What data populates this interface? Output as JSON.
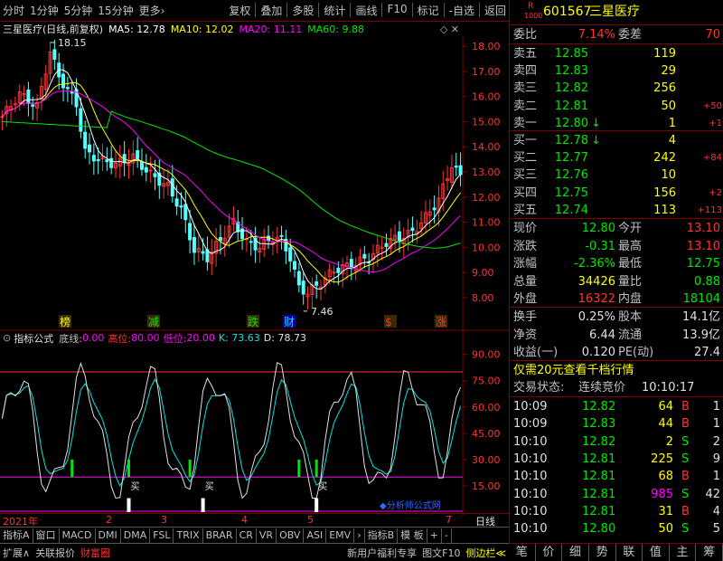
{
  "toolbar": {
    "left_items": [
      "分时",
      "1分钟",
      "5分钟",
      "15分钟",
      "更多›"
    ],
    "right_items": [
      "复权",
      "叠加",
      "多股",
      "统计",
      "画线",
      "F10",
      "标记",
      "-自选",
      "返回"
    ]
  },
  "chart_title": {
    "name": "三星医疗(日线,前复权)",
    "ma5": "MA5: 12.78",
    "ma10": "MA10: 12.02",
    "ma20": "MA20: 11.11",
    "ma60": "MA60: 9.88"
  },
  "chart_data": [
    {
      "type": "candlestick",
      "y_ticks": [
        "18.00",
        "17.00",
        "16.00",
        "15.00",
        "14.00",
        "13.00",
        "12.00",
        "11.00",
        "10.00",
        "9.00",
        "8.00"
      ],
      "ylim": [
        7.6,
        18.4
      ],
      "high_label": "18.15",
      "low_label": "7.46",
      "markers": [
        "榜",
        "减",
        "跌",
        "财",
        "$",
        "涨"
      ],
      "series_colors": {
        "ma5": "#ffffff",
        "ma10": "#ffff00",
        "ma20": "#ff00ff",
        "ma60": "#00e600"
      }
    },
    {
      "type": "line",
      "y_ticks": [
        "90.00",
        "75.00",
        "60.00",
        "45.00",
        "30.00",
        "15.00"
      ],
      "ylim": [
        0,
        95
      ],
      "buy_label": "买",
      "series_colors": {
        "k": "#e0e0e0",
        "d": "#00e6e6"
      }
    }
  ],
  "indicator": {
    "name": "指标公式",
    "floor_label": "底线:",
    "floor_value": "0.00",
    "high_label": "高位:",
    "high_value": "80.00",
    "low_label": "低位:",
    "low_value": "20.00",
    "k": "K: 73.63",
    "d": "D: 78.73",
    "link": "◆分析师公式网"
  },
  "xaxis": {
    "year": "2021年",
    "months": [
      "2",
      "3",
      "4",
      "5",
      "7"
    ],
    "period": "日线"
  },
  "tabs": [
    "指标A",
    "窗口",
    "MACD",
    "DMI",
    "DMA",
    "FSL",
    "TRIX",
    "BRAR",
    "CR",
    "VR",
    "OBV",
    "ASI",
    "EMV",
    "›",
    "指标B",
    "模 板",
    "+",
    "-"
  ],
  "bottom": {
    "left": [
      "扩展∧",
      "关联报价",
      "财富圈"
    ],
    "right": [
      "新用户福利专享",
      "图文F10",
      "侧边栏≪"
    ]
  },
  "stock": {
    "r_icon": "R",
    "code_small": "1000",
    "code": "601567",
    "name": "三星医疗"
  },
  "weibi": {
    "label": "委比",
    "value": "7.14%",
    "label2": "委差",
    "value2": "70"
  },
  "asks": [
    {
      "label": "卖五",
      "price": "12.85",
      "vol": "119",
      "chg": ""
    },
    {
      "label": "卖四",
      "price": "12.83",
      "vol": "29",
      "chg": ""
    },
    {
      "label": "卖三",
      "price": "12.82",
      "vol": "256",
      "chg": ""
    },
    {
      "label": "卖二",
      "price": "12.81",
      "vol": "50",
      "chg": "+50"
    },
    {
      "label": "卖一",
      "price": "12.80",
      "vol": "1",
      "chg": "+1",
      "arrow": "↓"
    }
  ],
  "bids": [
    {
      "label": "买一",
      "price": "12.78",
      "vol": "4",
      "chg": "",
      "arrow": "↓"
    },
    {
      "label": "买二",
      "price": "12.77",
      "vol": "242",
      "chg": "+84"
    },
    {
      "label": "买三",
      "price": "12.76",
      "vol": "10",
      "chg": ""
    },
    {
      "label": "买四",
      "price": "12.75",
      "vol": "156",
      "chg": "+2"
    },
    {
      "label": "买五",
      "price": "12.74",
      "vol": "113",
      "chg": "+113"
    }
  ],
  "quote": [
    {
      "l": "现价",
      "v": "12.80",
      "l2": "今开",
      "v2": "13.10"
    },
    {
      "l": "涨跌",
      "v": "-0.31",
      "l2": "最高",
      "v2": "13.10"
    },
    {
      "l": "涨幅",
      "v": "-2.36%",
      "l2": "最低",
      "v2": "12.75"
    },
    {
      "l": "总量",
      "v": "34426",
      "l2": "量比",
      "v2": "0.88"
    },
    {
      "l": "外盘",
      "v": "16322",
      "l2": "内盘",
      "v2": "18104"
    }
  ],
  "fin": [
    {
      "l": "换手",
      "v": "0.25%",
      "l2": "股本",
      "v2": "14.1亿"
    },
    {
      "l": "净资",
      "v": "6.44",
      "l2": "流通",
      "v2": "13.9亿"
    },
    {
      "l": "收益(一)",
      "v": "0.120",
      "l2": "PE(动)",
      "v2": "27.4"
    }
  ],
  "promo": "仅需20元查看千档行情",
  "status": {
    "label": "交易状态:",
    "value": "连续竞价",
    "time": "10:10:17"
  },
  "ticks": [
    {
      "t": "10:09",
      "p": "12.82",
      "v": "64",
      "s": "B",
      "n": "1"
    },
    {
      "t": "10:09",
      "p": "12.83",
      "v": "44",
      "s": "B",
      "n": "1"
    },
    {
      "t": "10:10",
      "p": "12.82",
      "v": "2",
      "s": "S",
      "n": "2"
    },
    {
      "t": "10:10",
      "p": "12.81",
      "v": "225",
      "s": "S",
      "n": "9"
    },
    {
      "t": "10:10",
      "p": "12.81",
      "v": "68",
      "s": "B",
      "n": "1"
    },
    {
      "t": "10:10",
      "p": "12.81",
      "v": "985",
      "s": "S",
      "n": "42"
    },
    {
      "t": "10:10",
      "p": "12.81",
      "v": "31",
      "s": "B",
      "n": "4"
    },
    {
      "t": "10:10",
      "p": "12.80",
      "v": "50",
      "s": "S",
      "n": "5"
    }
  ],
  "rtabs": [
    "笔",
    "价",
    "细",
    "势",
    "联",
    "值",
    "主",
    "筹"
  ]
}
